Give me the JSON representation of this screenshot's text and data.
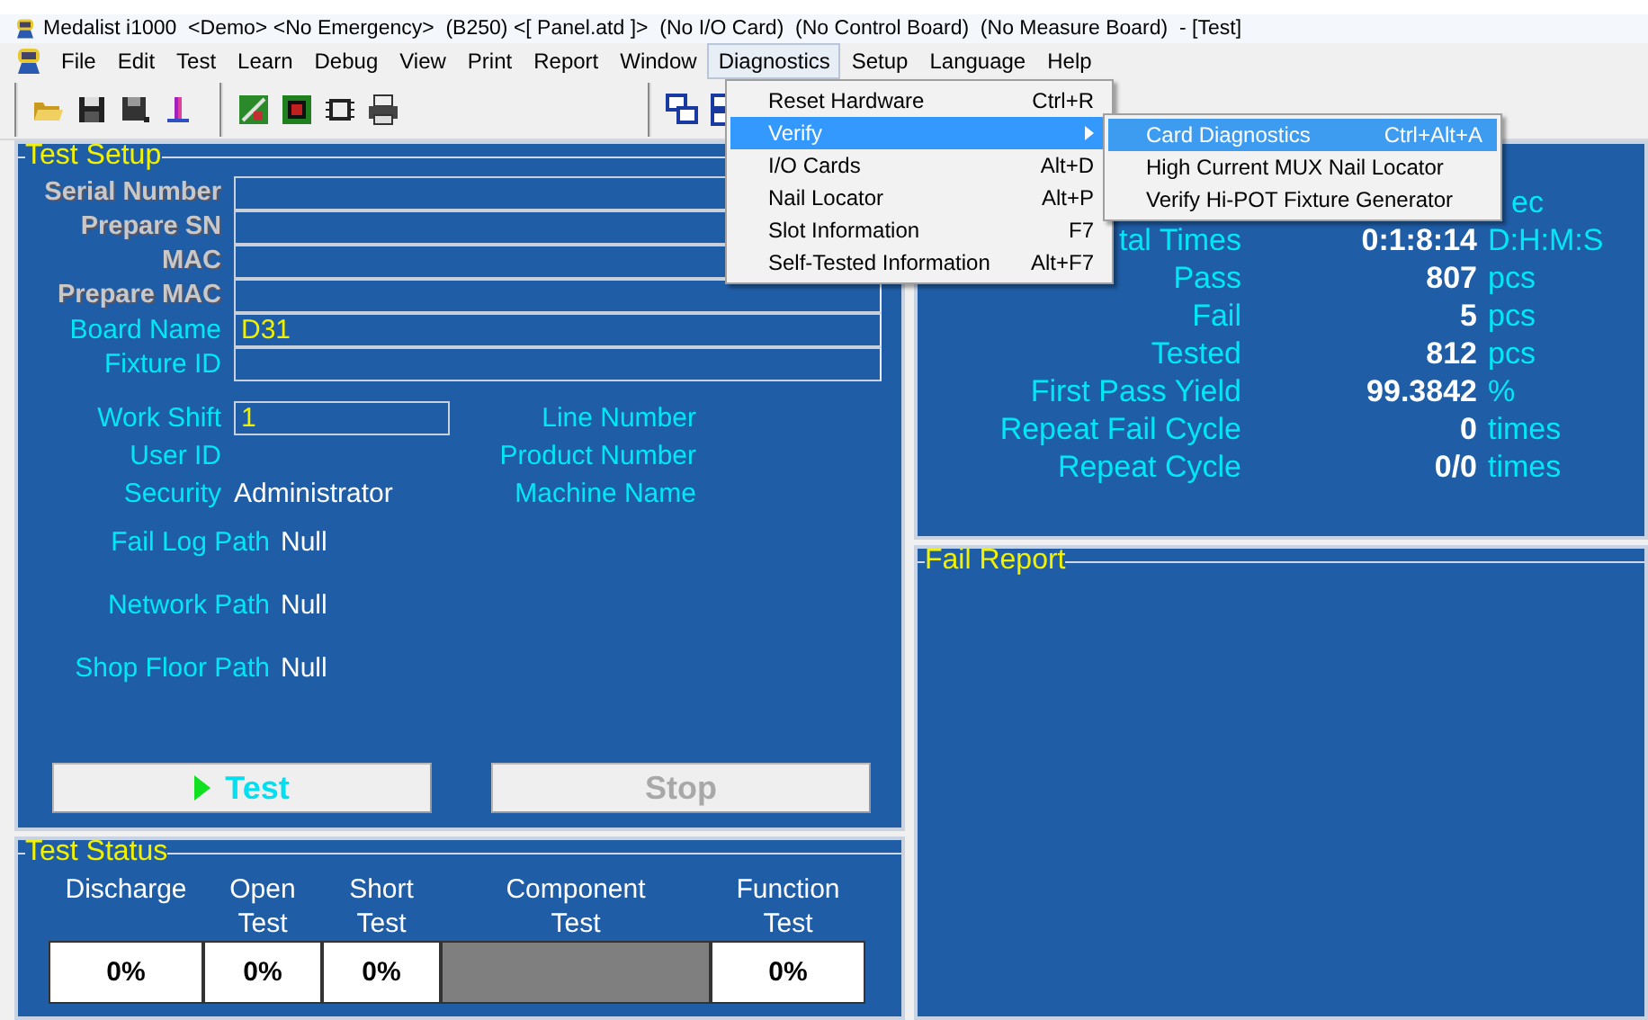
{
  "window": {
    "title": "Medalist i1000  <Demo> <No Emergency>  (B250) <[ Panel.atd ]>  (No I/O Card)  (No Control Board)  (No Measure Board)  - [Test]"
  },
  "menu_bar": {
    "items": [
      {
        "label": "File",
        "selected": false
      },
      {
        "label": "Edit",
        "selected": false
      },
      {
        "label": "Test",
        "selected": false
      },
      {
        "label": "Learn",
        "selected": false
      },
      {
        "label": "Debug",
        "selected": false
      },
      {
        "label": "View",
        "selected": false
      },
      {
        "label": "Print",
        "selected": false
      },
      {
        "label": "Report",
        "selected": false
      },
      {
        "label": "Window",
        "selected": false
      },
      {
        "label": "Diagnostics",
        "selected": true
      },
      {
        "label": "Setup",
        "selected": false
      },
      {
        "label": "Language",
        "selected": false
      },
      {
        "label": "Help",
        "selected": false
      }
    ]
  },
  "dropdown": {
    "items": [
      {
        "label": "Reset Hardware",
        "shortcut": "Ctrl+R",
        "selected": false,
        "submenu": false
      },
      {
        "label": "Verify",
        "selected": true,
        "submenu": true
      },
      {
        "label": "I/O Cards",
        "shortcut": "Alt+D",
        "selected": false,
        "submenu": false
      },
      {
        "label": "Nail Locator",
        "shortcut": "Alt+P",
        "selected": false,
        "submenu": false
      },
      {
        "label": "Slot Information",
        "shortcut": "F7",
        "selected": false,
        "submenu": false
      },
      {
        "label": "Self-Tested Information",
        "shortcut": "Alt+F7",
        "selected": false,
        "submenu": false
      }
    ]
  },
  "submenu": {
    "items": [
      {
        "label": "Card Diagnostics",
        "shortcut": "Ctrl+Alt+A",
        "selected": true
      },
      {
        "label": "High Current MUX Nail Locator",
        "selected": false
      },
      {
        "label": "Verify Hi-POT Fixture Generator",
        "selected": false
      }
    ]
  },
  "test_setup": {
    "title": "Test Setup",
    "fields": [
      {
        "label": "Serial Number",
        "disabled": true
      },
      {
        "label": "Prepare SN",
        "disabled": true
      },
      {
        "label": "MAC",
        "disabled": true
      },
      {
        "label": "Prepare MAC",
        "disabled": true
      },
      {
        "label": "Board Name",
        "value": "D31",
        "disabled": false
      },
      {
        "label": "Fixture ID",
        "disabled": false
      }
    ],
    "info_rows": [
      {
        "label": "Work Shift",
        "kind": "field",
        "value": "1",
        "side_label": "Line Number"
      },
      {
        "label": "User ID",
        "kind": "text",
        "side_label": "Product Number"
      },
      {
        "label": "Security",
        "kind": "text",
        "value": "Administrator",
        "side_label": "Machine Name"
      }
    ],
    "paths": [
      {
        "label": "Fail Log Path",
        "value": "Null"
      },
      {
        "label": "Network Path",
        "value": "Null"
      },
      {
        "label": "Shop Floor Path",
        "value": "Null"
      }
    ],
    "buttons": [
      {
        "label": "Test",
        "kind": "run",
        "disabled": false
      },
      {
        "label": "Stop",
        "kind": "stop",
        "disabled": true
      }
    ]
  },
  "statistics": {
    "rows": [
      {
        "unit": "ec"
      },
      {
        "label": "tal Times",
        "value": "0:1:8:14",
        "unit": "D:H:M:S"
      },
      {
        "label": "Pass",
        "value": "807",
        "unit": "pcs"
      },
      {
        "label": "Fail",
        "value": "5",
        "unit": "pcs"
      },
      {
        "label": "Tested",
        "value": "812",
        "unit": "pcs"
      },
      {
        "label": "First Pass Yield",
        "value": "99.3842",
        "unit": "%"
      },
      {
        "label": "Repeat Fail Cycle",
        "value": "0",
        "unit": "times"
      },
      {
        "label": "Repeat Cycle",
        "value": "0/0",
        "unit": "times"
      }
    ]
  },
  "fail_report": {
    "title": "Fail Report"
  },
  "test_status": {
    "title": "Test Status",
    "columns": [
      {
        "header": "Discharge",
        "value": "0%",
        "disabled": false
      },
      {
        "header": "Open Test",
        "value": "0%",
        "disabled": false
      },
      {
        "header": "Short Test",
        "value": "0%",
        "disabled": false
      },
      {
        "header": "Component Test",
        "disabled": true
      },
      {
        "header": "Function Test",
        "value": "0%",
        "disabled": false
      }
    ]
  }
}
